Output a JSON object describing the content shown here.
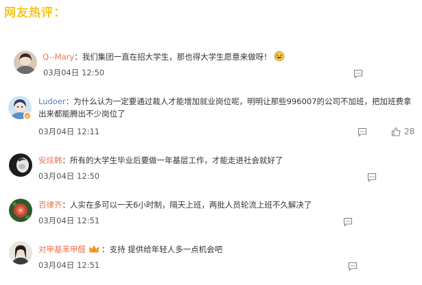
{
  "header": {
    "title": "网友热评："
  },
  "comments": [
    {
      "username": "Q--Mary",
      "separator": "：",
      "text": "我们集团一直在招大学生，那也得大学生愿意来做呀！",
      "date": "03月04日",
      "time": "12:50"
    },
    {
      "username": "Ludoer",
      "separator": "：",
      "text": "为什么认为一定要通过裁人才能增加就业岗位呢，明明让那些996007的公司不加班，把加班费拿出来都能腾出不少岗位了",
      "date": "03月04日",
      "time": "12:11",
      "likes": "28"
    },
    {
      "username": "安炫韩",
      "separator": "：",
      "text": "所有的大学生毕业后要做一年基层工作，才能走进社会就好了",
      "date": "03月04日",
      "time": "12:50"
    },
    {
      "username": "百律齐",
      "separator": "：",
      "text": "人实在多可以一天6小时制，隔天上班，两批人员轮流上班不久解决了",
      "date": "03月04日",
      "time": "12:51"
    },
    {
      "username": "对甲基苯甲醛",
      "separator": "：",
      "text": "支持 提供给年轻人多一点机会吧",
      "date": "03月04日",
      "time": "12:51"
    }
  ],
  "colors": {
    "header": "#f5c518",
    "username": "#eb7350",
    "username_alt": "#507daf",
    "icon": "#808080"
  },
  "icons": [
    "reply-icon",
    "like-icon",
    "laugh-emoji-icon",
    "crown-icon",
    "verified-badge-icon"
  ]
}
